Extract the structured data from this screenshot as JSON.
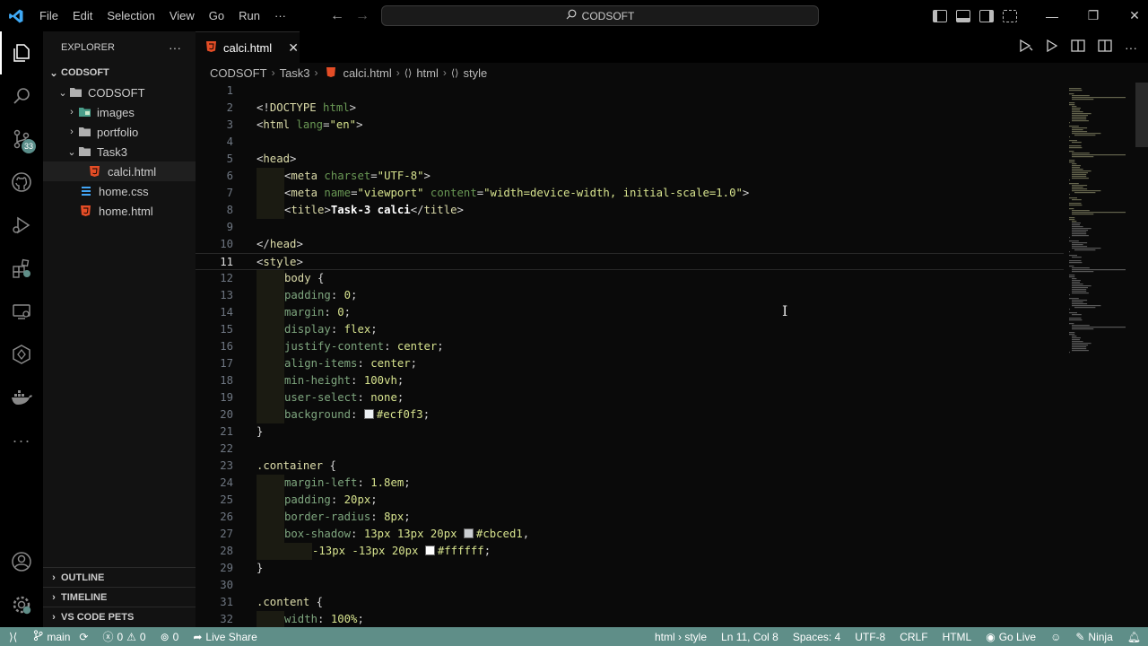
{
  "titlebar": {
    "menu": [
      "File",
      "Edit",
      "Selection",
      "View",
      "Go",
      "Run",
      "···"
    ],
    "command_center": "CODSOFT"
  },
  "activitybar": {
    "scm_badge": "33"
  },
  "sidebar": {
    "header": "EXPLORER",
    "more": "···",
    "workspace": "CODSOFT",
    "tree": [
      {
        "label": "CODSOFT",
        "type": "folder-open"
      },
      {
        "label": "images",
        "type": "folder-images"
      },
      {
        "label": "portfolio",
        "type": "folder"
      },
      {
        "label": "Task3",
        "type": "folder-open"
      },
      {
        "label": "calci.html",
        "type": "html"
      },
      {
        "label": "home.css",
        "type": "css"
      },
      {
        "label": "home.html",
        "type": "html"
      }
    ],
    "sections": [
      "OUTLINE",
      "TIMELINE",
      "VS CODE PETS"
    ]
  },
  "editor": {
    "tab": "calci.html",
    "breadcrumb": [
      "CODSOFT",
      "Task3",
      "calci.html",
      "html",
      "style"
    ],
    "current_line": "11"
  },
  "code_lines": [
    {
      "n": "1",
      "i": 0,
      "seg": []
    },
    {
      "n": "2",
      "i": 0,
      "seg": [
        [
          "t-brk",
          "<!"
        ],
        [
          "t-tag",
          "DOCTYPE"
        ],
        [
          "t-attr",
          " html"
        ],
        [
          "t-brk",
          ">"
        ]
      ]
    },
    {
      "n": "3",
      "i": 0,
      "seg": [
        [
          "t-brk",
          "<"
        ],
        [
          "t-tag",
          "html"
        ],
        [
          "t-attr",
          " lang"
        ],
        [
          "t-punc",
          "="
        ],
        [
          "t-str",
          "\"en\""
        ],
        [
          "t-brk",
          ">"
        ]
      ]
    },
    {
      "n": "4",
      "i": 0,
      "seg": []
    },
    {
      "n": "5",
      "i": 0,
      "seg": [
        [
          "t-brk",
          "<"
        ],
        [
          "t-tag",
          "head"
        ],
        [
          "t-brk",
          ">"
        ]
      ]
    },
    {
      "n": "6",
      "i": 1,
      "seg": [
        [
          "t-brk",
          "<"
        ],
        [
          "t-tag",
          "meta"
        ],
        [
          "t-attr",
          " charset"
        ],
        [
          "t-punc",
          "="
        ],
        [
          "t-str",
          "\"UTF-8\""
        ],
        [
          "t-brk",
          ">"
        ]
      ]
    },
    {
      "n": "7",
      "i": 1,
      "seg": [
        [
          "t-brk",
          "<"
        ],
        [
          "t-tag",
          "meta"
        ],
        [
          "t-attr",
          " name"
        ],
        [
          "t-punc",
          "="
        ],
        [
          "t-str",
          "\"viewport\""
        ],
        [
          "t-attr",
          " content"
        ],
        [
          "t-punc",
          "="
        ],
        [
          "t-str",
          "\"width=device-width, initial-scale=1.0\""
        ],
        [
          "t-brk",
          ">"
        ]
      ]
    },
    {
      "n": "8",
      "i": 1,
      "seg": [
        [
          "t-brk",
          "<"
        ],
        [
          "t-tag",
          "title"
        ],
        [
          "t-brk",
          ">"
        ],
        [
          "t-bold",
          "Task-3 calci"
        ],
        [
          "t-brk",
          "</"
        ],
        [
          "t-tag",
          "title"
        ],
        [
          "t-brk",
          ">"
        ]
      ]
    },
    {
      "n": "9",
      "i": 0,
      "seg": []
    },
    {
      "n": "10",
      "i": 0,
      "seg": [
        [
          "t-brk",
          "</"
        ],
        [
          "t-tag",
          "head"
        ],
        [
          "t-brk",
          ">"
        ]
      ]
    },
    {
      "n": "11",
      "i": 0,
      "seg": [
        [
          "t-brk",
          "<"
        ],
        [
          "t-tag",
          "style"
        ],
        [
          "t-brk",
          ">"
        ]
      ]
    },
    {
      "n": "12",
      "i": 1,
      "seg": [
        [
          "t-sel",
          "body"
        ],
        [
          "t-punc",
          " {"
        ]
      ]
    },
    {
      "n": "13",
      "i": 1,
      "seg": [
        [
          "t-prop",
          "padding"
        ],
        [
          "t-punc",
          ": "
        ],
        [
          "t-num",
          "0"
        ],
        [
          "t-punc",
          ";"
        ]
      ]
    },
    {
      "n": "14",
      "i": 1,
      "seg": [
        [
          "t-prop",
          "margin"
        ],
        [
          "t-punc",
          ": "
        ],
        [
          "t-num",
          "0"
        ],
        [
          "t-punc",
          ";"
        ]
      ]
    },
    {
      "n": "15",
      "i": 1,
      "seg": [
        [
          "t-prop",
          "display"
        ],
        [
          "t-punc",
          ": "
        ],
        [
          "t-num",
          "flex"
        ],
        [
          "t-punc",
          ";"
        ]
      ]
    },
    {
      "n": "16",
      "i": 1,
      "seg": [
        [
          "t-prop",
          "justify-content"
        ],
        [
          "t-punc",
          ": "
        ],
        [
          "t-num",
          "center"
        ],
        [
          "t-punc",
          ";"
        ]
      ]
    },
    {
      "n": "17",
      "i": 1,
      "seg": [
        [
          "t-prop",
          "align-items"
        ],
        [
          "t-punc",
          ": "
        ],
        [
          "t-num",
          "center"
        ],
        [
          "t-punc",
          ";"
        ]
      ]
    },
    {
      "n": "18",
      "i": 1,
      "seg": [
        [
          "t-prop",
          "min-height"
        ],
        [
          "t-punc",
          ": "
        ],
        [
          "t-num",
          "100vh"
        ],
        [
          "t-punc",
          ";"
        ]
      ]
    },
    {
      "n": "19",
      "i": 1,
      "seg": [
        [
          "t-prop",
          "user-select"
        ],
        [
          "t-punc",
          ": "
        ],
        [
          "t-num",
          "none"
        ],
        [
          "t-punc",
          ";"
        ]
      ]
    },
    {
      "n": "20",
      "i": 1,
      "seg": [
        [
          "t-prop",
          "background"
        ],
        [
          "t-punc",
          ": "
        ],
        [
          "sw",
          "#ecf0f3"
        ],
        [
          "t-num",
          "#ecf0f3"
        ],
        [
          "t-punc",
          ";"
        ]
      ]
    },
    {
      "n": "21",
      "i": 0,
      "seg": [
        [
          "t-punc",
          "}"
        ]
      ]
    },
    {
      "n": "22",
      "i": 0,
      "seg": []
    },
    {
      "n": "23",
      "i": 0,
      "seg": [
        [
          "t-sel",
          ".container"
        ],
        [
          "t-punc",
          " {"
        ]
      ]
    },
    {
      "n": "24",
      "i": 1,
      "seg": [
        [
          "t-prop",
          "margin-left"
        ],
        [
          "t-punc",
          ": "
        ],
        [
          "t-num",
          "1.8em"
        ],
        [
          "t-punc",
          ";"
        ]
      ]
    },
    {
      "n": "25",
      "i": 1,
      "seg": [
        [
          "t-prop",
          "padding"
        ],
        [
          "t-punc",
          ": "
        ],
        [
          "t-num",
          "20px"
        ],
        [
          "t-punc",
          ";"
        ]
      ]
    },
    {
      "n": "26",
      "i": 1,
      "seg": [
        [
          "t-prop",
          "border-radius"
        ],
        [
          "t-punc",
          ": "
        ],
        [
          "t-num",
          "8px"
        ],
        [
          "t-punc",
          ";"
        ]
      ]
    },
    {
      "n": "27",
      "i": 1,
      "seg": [
        [
          "t-prop",
          "box-shadow"
        ],
        [
          "t-punc",
          ": "
        ],
        [
          "t-num",
          "13px 13px 20px "
        ],
        [
          "sw",
          "#cbced1"
        ],
        [
          "t-num",
          "#cbced1"
        ],
        [
          "t-punc",
          ","
        ]
      ]
    },
    {
      "n": "28",
      "i": 2,
      "seg": [
        [
          "t-num",
          "-13px -13px 20px "
        ],
        [
          "sw",
          "#ffffff"
        ],
        [
          "t-num",
          "#ffffff"
        ],
        [
          "t-punc",
          ";"
        ]
      ]
    },
    {
      "n": "29",
      "i": 0,
      "seg": [
        [
          "t-punc",
          "}"
        ]
      ]
    },
    {
      "n": "30",
      "i": 0,
      "seg": []
    },
    {
      "n": "31",
      "i": 0,
      "seg": [
        [
          "t-sel",
          ".content"
        ],
        [
          "t-punc",
          " {"
        ]
      ]
    },
    {
      "n": "32",
      "i": 1,
      "seg": [
        [
          "t-prop",
          "width"
        ],
        [
          "t-punc",
          ": "
        ],
        [
          "t-num",
          "100%"
        ],
        [
          "t-punc",
          ";"
        ]
      ]
    }
  ],
  "statusbar": {
    "branch": "main",
    "errors": "0",
    "warnings": "0",
    "ports": "0",
    "live_share": "Live Share",
    "breadcrumb": "html › style",
    "position": "Ln 11, Col 8",
    "spaces": "Spaces: 4",
    "encoding": "UTF-8",
    "eol": "CRLF",
    "language": "HTML",
    "go_live": "Go Live",
    "theme": "Ninja"
  },
  "colors": {
    "statusbar": "#5f8e88",
    "html_icon": "#e44d26",
    "css_icon": "#42a5f5",
    "folder": "#c5c5c5"
  }
}
